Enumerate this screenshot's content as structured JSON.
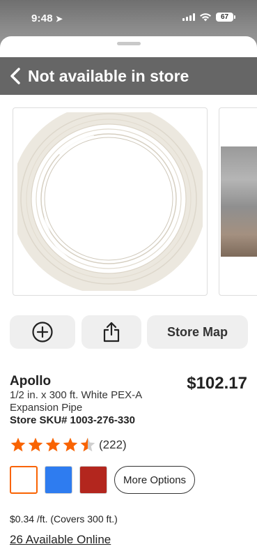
{
  "status_bar": {
    "time": "9:48",
    "battery": "67"
  },
  "header": {
    "title": "Not available in store",
    "back_icon": "chevron-left-icon"
  },
  "gallery": {
    "images": [
      {
        "alt": "PEX pipe coil"
      },
      {
        "alt": "product photo"
      }
    ]
  },
  "actions": {
    "add_icon": "plus-circle-icon",
    "share_icon": "share-icon",
    "store_map_label": "Store Map"
  },
  "product": {
    "brand": "Apollo",
    "description": "1/2 in. x 300 ft. White PEX-A Expansion Pipe",
    "sku_label": "Store SKU#",
    "sku": "1003-276-330",
    "price": "$102.17",
    "rating": 4.5,
    "review_count": "(222)",
    "unit_price": "$0.34 /ft. (Covers 300 ft.)",
    "availability": "26 Available Online"
  },
  "options": {
    "swatches": [
      {
        "name": "white",
        "color": "#ffffff",
        "selected": true
      },
      {
        "name": "blue",
        "color": "#2e7cf0",
        "selected": false
      },
      {
        "name": "red",
        "color": "#b3261e",
        "selected": false
      }
    ],
    "more_options_label": "More Options"
  },
  "colors": {
    "accent": "#f96302",
    "header_bg": "#666666",
    "star": "#f96302"
  }
}
